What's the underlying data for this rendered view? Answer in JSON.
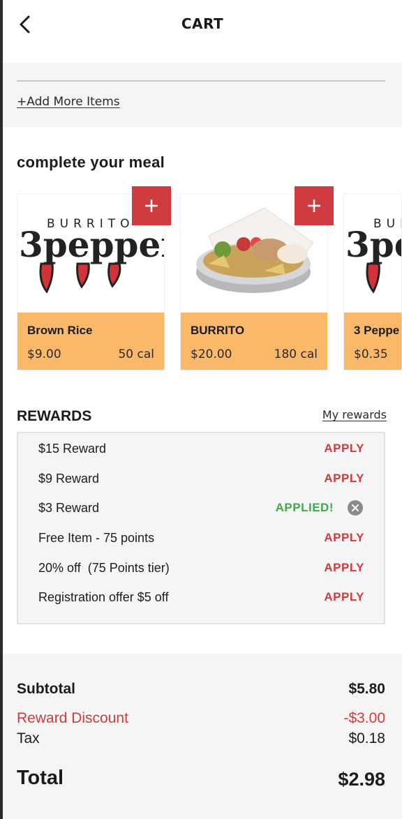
{
  "header": {
    "title": "CART",
    "back_icon": "chevron-left-icon"
  },
  "cart": {
    "add_more_label": "+Add More Items"
  },
  "meal": {
    "heading": "complete your meal",
    "items": [
      {
        "name": "Brown Rice",
        "price": "$9.00",
        "calories": "50 cal",
        "image": "burrito-3pepper-logo"
      },
      {
        "name": "BURRITO",
        "price": "$20.00",
        "calories": "180 cal",
        "image": "burrito-bowl-photo"
      },
      {
        "name": "3 Peppe",
        "price": "$0.35",
        "calories": "",
        "image": "burrito-3pepper-logo"
      }
    ],
    "logo_text": {
      "top": "BURRITO",
      "main": "3pepper"
    }
  },
  "rewards": {
    "heading": "REWARDS",
    "my_rewards_label": "My rewards",
    "items": [
      {
        "label": "$15 Reward",
        "action": "APPLY"
      },
      {
        "label": "$9 Reward",
        "action": "APPLY"
      },
      {
        "label": "$3 Reward",
        "action": "APPLIED!"
      },
      {
        "label": "Free Item - 75 points",
        "action": "APPLY"
      },
      {
        "label": "20% off  (75 Points tier)",
        "action": "APPLY"
      },
      {
        "label": "Registration offer $5 off",
        "action": "APPLY"
      }
    ]
  },
  "summary": {
    "subtotal_label": "Subtotal",
    "subtotal_value": "$5.80",
    "discount_label": "Reward Discount",
    "discount_value": "-$3.00",
    "tax_label": "Tax",
    "tax_value": "$0.18",
    "total_label": "Total",
    "total_value": "$2.98"
  },
  "colors": {
    "accent_red": "#cf3b3e",
    "card_orange": "#fbb868",
    "applied_green": "#3faa4a"
  }
}
